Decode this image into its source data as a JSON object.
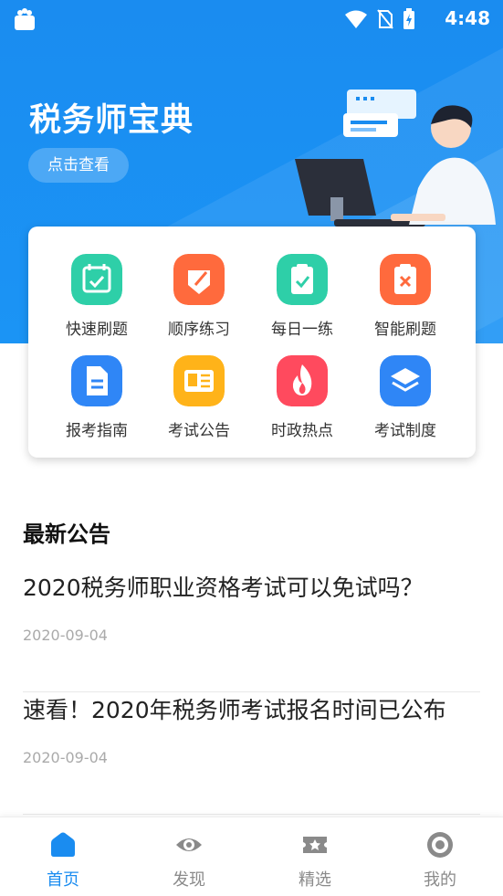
{
  "status_bar": {
    "time": "4:48"
  },
  "header": {
    "title": "税务师宝典",
    "view_button": "点击查看"
  },
  "grid": [
    {
      "label": "快速刷题",
      "icon": "calendar-check-icon",
      "color": "#2ecfa8"
    },
    {
      "label": "顺序练习",
      "icon": "pen-tag-icon",
      "color": "#ff6a3d"
    },
    {
      "label": "每日一练",
      "icon": "clipboard-check-icon",
      "color": "#2ecfa8"
    },
    {
      "label": "智能刷题",
      "icon": "clipboard-x-icon",
      "color": "#ff6a3d"
    },
    {
      "label": "报考指南",
      "icon": "document-icon",
      "color": "#2f86f6"
    },
    {
      "label": "考试公告",
      "icon": "newspaper-icon",
      "color": "#ffb319"
    },
    {
      "label": "时政热点",
      "icon": "flame-icon",
      "color": "#ff4a5e"
    },
    {
      "label": "考试制度",
      "icon": "layers-icon",
      "color": "#2f86f6"
    }
  ],
  "news": {
    "section_title": "最新公告",
    "items": [
      {
        "title": "2020税务师职业资格考试可以免试吗？",
        "date": "2020-09-04"
      },
      {
        "title": "速看！2020年税务师考试报名时间已公布",
        "date": "2020-09-04"
      }
    ]
  },
  "bottom_nav": [
    {
      "label": "首页",
      "icon": "home-icon",
      "active": true
    },
    {
      "label": "发现",
      "icon": "eye-icon",
      "active": false
    },
    {
      "label": "精选",
      "icon": "ticket-star-icon",
      "active": false
    },
    {
      "label": "我的",
      "icon": "profile-circle-icon",
      "active": false
    }
  ],
  "colors": {
    "primary": "#1a8cf0",
    "nav_inactive": "#8a8a8a"
  }
}
